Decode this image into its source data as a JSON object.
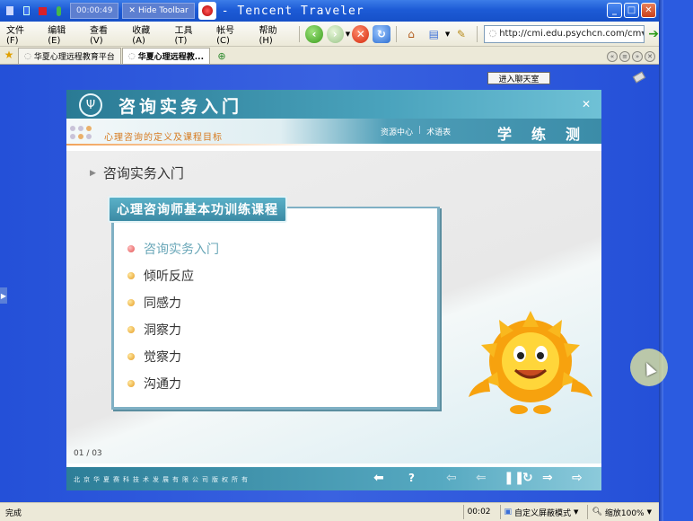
{
  "recorder": {
    "time": "00:00:49",
    "hide_toolbar": "Hide Toolbar"
  },
  "window": {
    "title": "- Tencent Traveler"
  },
  "menu": {
    "items": [
      "文件(F)",
      "编辑(E)",
      "查看(V)",
      "收藏(A)",
      "工具(T)",
      "帐号(C)",
      "帮助(H)"
    ]
  },
  "address": {
    "url": "http://cmi.edu.psychcn.com/cm"
  },
  "tabs": [
    {
      "label": "华夏心理远程教育平台"
    },
    {
      "label": "华夏心理远程教..."
    }
  ],
  "page": {
    "chat_button": "进入聊天室",
    "course": {
      "title": "咨询实务入门",
      "subtitle": "心理咨询的定义及课程目标",
      "links": [
        "资源中心",
        "术语表"
      ],
      "modes": [
        "学",
        "练",
        "测"
      ],
      "section_title": "咨询实务入门",
      "box_label": "心理咨询师基本功训练课程",
      "items": [
        {
          "label": "咨询实务入门",
          "active": true
        },
        {
          "label": "倾听反应",
          "active": false
        },
        {
          "label": "同感力",
          "active": false
        },
        {
          "label": "洞察力",
          "active": false
        },
        {
          "label": "觉察力",
          "active": false
        },
        {
          "label": "沟通力",
          "active": false
        }
      ],
      "page_indicator": "01 / 03",
      "copyright": "北京华夏赛科技术发展有限公司版权所有"
    }
  },
  "status": {
    "text": "完成",
    "time": "00:02",
    "screen_mode": "自定义屏蔽模式",
    "zoom": "缩放100%"
  },
  "colors": {
    "titlebar": "#1d5bd6",
    "content_bg": "#2450d8",
    "course_teal": "#3b8aa4",
    "accent_orange": "#d67a1f"
  }
}
